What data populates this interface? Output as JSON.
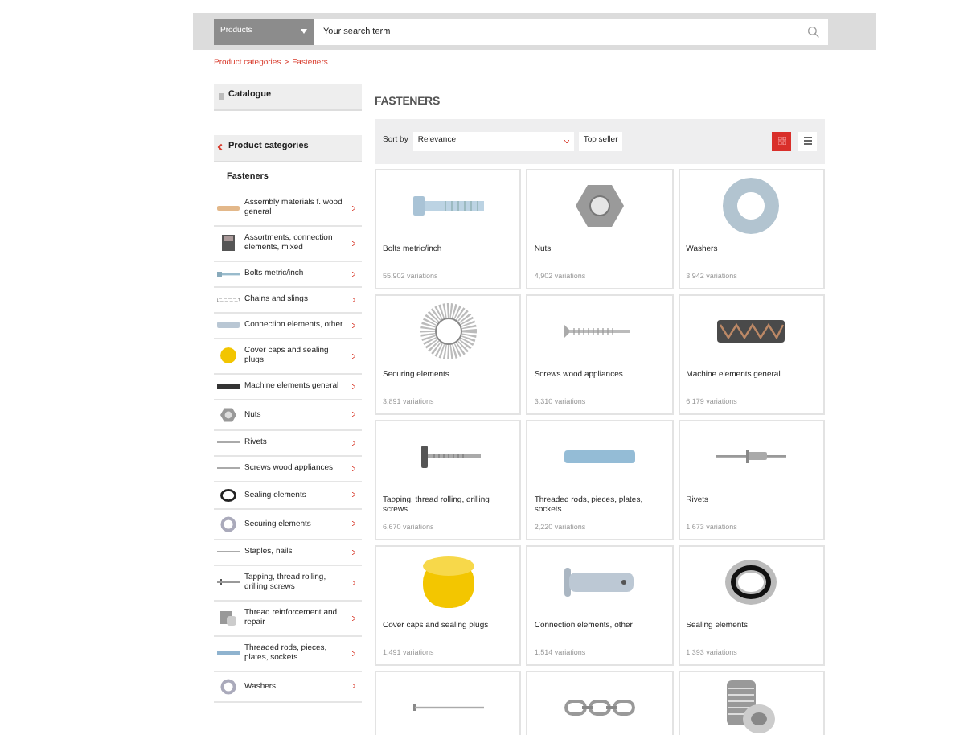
{
  "header": {
    "scope_dropdown": "Products",
    "search": {
      "placeholder": "Your search term"
    }
  },
  "breadcrumb": [
    "Product categories",
    "Fasteners"
  ],
  "breadcrumb_separator": ">",
  "sidebar": {
    "catalogue": "Catalogue",
    "back_link": "Product categories",
    "current": "Fasteners",
    "items": [
      {
        "label": "Assembly materials f. wood general",
        "kind": "strip"
      },
      {
        "label": "Assortments, connection elements, mixed",
        "kind": "box"
      },
      {
        "label": "Bolts metric/inch",
        "kind": "bolt"
      },
      {
        "label": "Chains and slings",
        "kind": "chain"
      },
      {
        "label": "Connection elements, other",
        "kind": "plate"
      },
      {
        "label": "Cover caps and sealing plugs",
        "kind": "cap"
      },
      {
        "label": "Machine elements general",
        "kind": "bar"
      },
      {
        "label": "Nuts",
        "kind": "nut"
      },
      {
        "label": "Rivets",
        "kind": "line"
      },
      {
        "label": "Screws wood appliances",
        "kind": "line"
      },
      {
        "label": "Sealing elements",
        "kind": "seal"
      },
      {
        "label": "Securing elements",
        "kind": "washer"
      },
      {
        "label": "Staples, nails",
        "kind": "line"
      },
      {
        "label": "Tapping, thread rolling, drilling screws",
        "kind": "screw"
      },
      {
        "label": "Thread reinforcement and repair",
        "kind": "insert"
      },
      {
        "label": "Threaded rods, pieces, plates, sockets",
        "kind": "rod"
      },
      {
        "label": "Washers",
        "kind": "washer"
      }
    ]
  },
  "title": "FASTENERS",
  "toolbar": {
    "sort_label": "Sort by",
    "sort_value": "Relevance",
    "top_seller": "Top seller",
    "views": [
      {
        "kind": "grid",
        "selected": true
      },
      {
        "kind": "list",
        "selected": false
      }
    ]
  },
  "cards": [
    {
      "title": "Bolts metric/inch",
      "count": "55,902 variations",
      "kind": "bolt"
    },
    {
      "title": "Nuts",
      "count": "4,902 variations",
      "kind": "nut"
    },
    {
      "title": "Washers",
      "count": "3,942 variations",
      "kind": "washer"
    },
    {
      "title": "Securing elements",
      "count": "3,891 variations",
      "kind": "lockwasher"
    },
    {
      "title": "Screws wood appliances",
      "count": "3,310 variations",
      "kind": "woodscrew"
    },
    {
      "title": "Machine elements general",
      "count": "6,179 variations",
      "kind": "spring"
    },
    {
      "title": "Tapping, thread rolling, drilling screws",
      "count": "6,670 variations",
      "kind": "screw"
    },
    {
      "title": "Threaded rods, pieces, plates, sockets",
      "count": "2,220 variations",
      "kind": "rod"
    },
    {
      "title": "Rivets",
      "count": "1,673 variations",
      "kind": "rivet"
    },
    {
      "title": "Cover caps and sealing plugs",
      "count": "1,491 variations",
      "kind": "cap"
    },
    {
      "title": "Connection elements, other",
      "count": "1,514 variations",
      "kind": "pin"
    },
    {
      "title": "Sealing elements",
      "count": "1,393 variations",
      "kind": "seal"
    },
    {
      "kind": "nail"
    },
    {
      "kind": "chain"
    },
    {
      "kind": "insert"
    }
  ]
}
